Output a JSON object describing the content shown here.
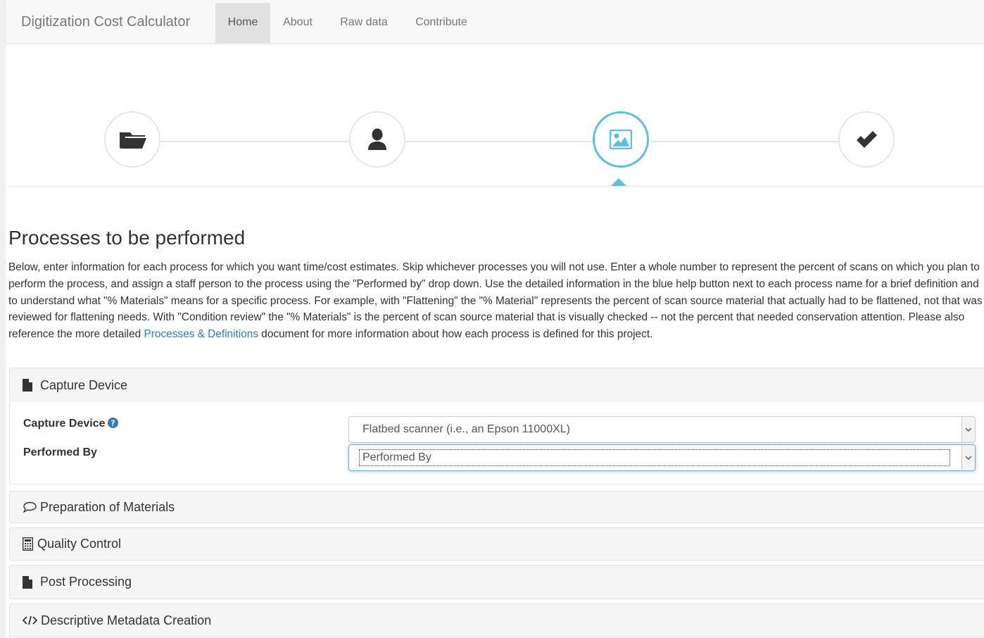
{
  "navbar": {
    "brand": "Digitization Cost Calculator",
    "items": [
      {
        "label": "Home",
        "active": true
      },
      {
        "label": "About",
        "active": false
      },
      {
        "label": "Raw data",
        "active": false
      },
      {
        "label": "Contribute",
        "active": false
      }
    ]
  },
  "wizard": {
    "steps": [
      {
        "icon": "folder-open-icon",
        "active": false
      },
      {
        "icon": "user-icon",
        "active": false
      },
      {
        "icon": "picture-icon",
        "active": true
      },
      {
        "icon": "checkmark-icon",
        "active": false
      }
    ],
    "accent_color": "#5bc0de"
  },
  "content": {
    "title": "Processes to be performed",
    "intro_before_link": "Below, enter information for each process for which you want time/cost estimates. Skip whichever processes you will not use. Enter a whole number to represent the percent of scans on which you plan to perform the process, and assign a staff person to the process using the \"Performed by\" drop down. Use the detailed information in the blue help button next to each process name for a brief definition and to understand what \"% Materials\" means for a specific process. For example, with \"Flattening\" the \"% Material\" represents the percent of scan source material that actually had to be flattened, not that was reviewed for flattening needs. With \"Condition review\" the \"% Materials\" is the percent of scan source material that is visually checked -- not the percent that needed conservation attention. Please also reference the more detailed ",
    "intro_link": "Processes & Definitions",
    "intro_after_link": " document for more information about how each process is defined for this project.",
    "link_color": "#337ab7"
  },
  "panels": [
    {
      "title": "Capture Device",
      "icon": "file-icon",
      "expanded": true
    },
    {
      "title": "Preparation of Materials",
      "icon": "comment-icon",
      "expanded": false
    },
    {
      "title": "Quality Control",
      "icon": "calculator-icon",
      "expanded": false
    },
    {
      "title": "Post Processing",
      "icon": "file-icon",
      "expanded": false
    },
    {
      "title": "Descriptive Metadata Creation",
      "icon": "code-icon",
      "expanded": false
    }
  ],
  "capture_form": {
    "device_label": "Capture Device",
    "device_value": "Flatbed scanner (i.e., an Epson 11000XL)",
    "performed_label": "Performed By",
    "performed_value": "Performed By"
  }
}
